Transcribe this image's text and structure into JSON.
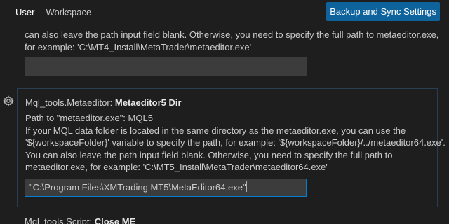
{
  "header": {
    "tabs": [
      {
        "label": "User"
      },
      {
        "label": "Workspace"
      }
    ],
    "sync_button_label": "Backup and Sync Settings"
  },
  "settings": {
    "previous": {
      "description_lines": [
        "can also leave the path input field blank. Otherwise, you need to specify the full path to metaeditor.exe,",
        "for example: 'C:\\MT4_Install\\MetaTrader\\metaeditor.exe'"
      ],
      "value": ""
    },
    "metaeditor5": {
      "category": "Mql_tools.Metaeditor: ",
      "name": "Metaeditor5 Dir",
      "description_lines": [
        "Path to \"metaeditor.exe\": MQL5",
        "If your MQL data folder is located in the same directory as the metaeditor.exe, you can use the",
        "'${workspaceFolder}' variable to specify the path, for example: '${workspaceFolder}/../metaeditor64.exe'.",
        "You can also leave the path input field blank. Otherwise, you need to specify the full path to",
        "metaeditor.exe, for example: 'C:\\MT5_Install\\MetaTrader\\metaeditor64.exe'"
      ],
      "value": "\"C:\\Program Files\\XMTrading MT5\\MetaEditor64.exe\""
    },
    "next": {
      "category": "Mql_tools.Script: ",
      "name": "Close ME"
    }
  },
  "colors": {
    "background": "#1e1e1e",
    "accent": "#0e639c",
    "focus_border": "#007fd4",
    "input_background": "#3c3c3c"
  },
  "icons": {
    "settings_gear": "gear-icon"
  }
}
